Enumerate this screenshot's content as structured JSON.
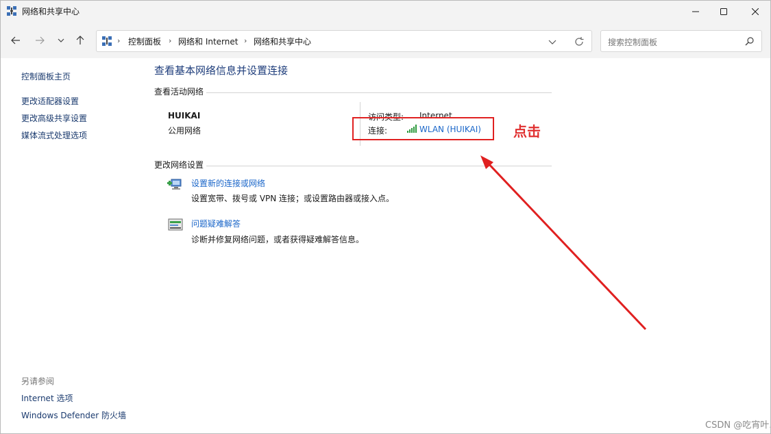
{
  "window": {
    "title": "网络和共享中心",
    "icons": {
      "app": "network-icon",
      "minimize": "minimize-icon",
      "maximize": "maximize-icon",
      "close": "close-icon"
    }
  },
  "nav": {
    "breadcrumb": [
      "控制面板",
      "网络和 Internet",
      "网络和共享中心"
    ],
    "search_placeholder": "搜索控制面板",
    "icons": [
      "back-arrow-icon",
      "forward-arrow-icon",
      "chevron-down-icon",
      "up-arrow-icon",
      "refresh-icon",
      "search-icon"
    ]
  },
  "sidebar": {
    "home": "控制面板主页",
    "links": [
      "更改适配器设置",
      "更改高级共享设置",
      "媒体流式处理选项"
    ],
    "see_also_label": "另请参阅",
    "see_also": [
      "Internet 选项",
      "Windows Defender 防火墙"
    ]
  },
  "main": {
    "title": "查看基本网络信息并设置连接",
    "active_section": "查看活动网络",
    "network": {
      "name": "HUIKAI",
      "type": "公用网络",
      "access_label": "访问类型:",
      "access_value": "Internet",
      "connection_label": "连接:",
      "connection_value": "WLAN (HUIKAI)"
    },
    "change_section": "更改网络设置",
    "tasks": [
      {
        "link": "设置新的连接或网络",
        "desc": "设置宽带、拨号或 VPN 连接；或设置路由器或接入点。"
      },
      {
        "link": "问题疑难解答",
        "desc": "诊断并修复网络问题，或者获得疑难解答信息。"
      }
    ]
  },
  "annotation": {
    "label": "点击",
    "color": "#e02020"
  },
  "watermark": "CSDN @吃宵叶."
}
